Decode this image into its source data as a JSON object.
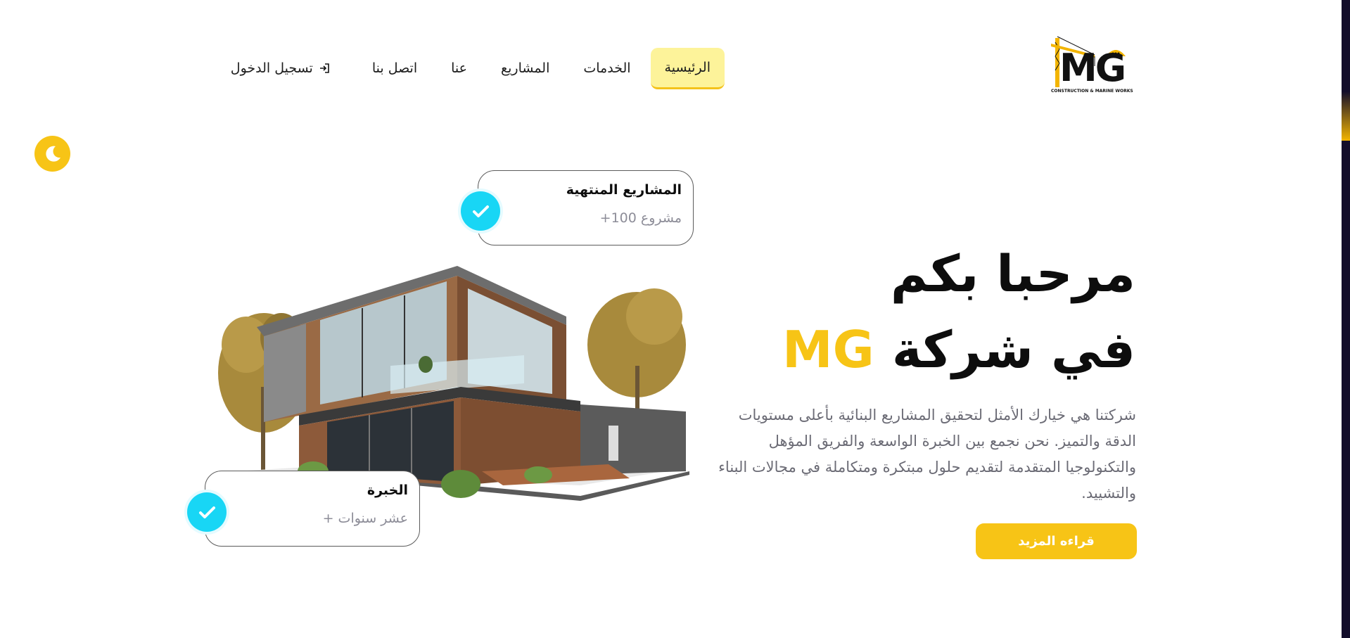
{
  "nav": {
    "items": [
      {
        "label": "الرئيسية",
        "active": true
      },
      {
        "label": "الخدمات",
        "active": false
      },
      {
        "label": "المشاريع",
        "active": false
      },
      {
        "label": "عنا",
        "active": false
      },
      {
        "label": "اتصل بنا",
        "active": false
      }
    ],
    "login_label": "تسجيل الدخول",
    "login_icon": "login-icon"
  },
  "logo": {
    "text_m": "M",
    "text_g": "G",
    "tagline": "CONSTRUCTION & MARINE WORKS"
  },
  "theme_toggle_icon": "moon-icon",
  "hero": {
    "title_line1": "مرحبا بكم",
    "title_line2_prefix": "في شركة",
    "title_line2_brand": "MG",
    "description": "شركتنا هي خيارك الأمثل لتحقيق المشاريع البنائية بأعلى مستويات الدقة والتميز. نحن نجمع بين الخبرة الواسعة والفريق المؤهل والتكنولوجيا المتقدمة لتقديم حلول مبتكرة ومتكاملة في مجالات البناء والتشييد.",
    "cta_label": "قراءه المزيد"
  },
  "stats": {
    "projects": {
      "title": "المشاريع المنتهية",
      "value": "مشروع 100+"
    },
    "experience": {
      "title": "الخبرة",
      "value": "عشر سنوات +"
    }
  },
  "colors": {
    "accent": "#f7c416",
    "check": "#18d6f5",
    "nav_active_bg": "#fdf39a"
  }
}
